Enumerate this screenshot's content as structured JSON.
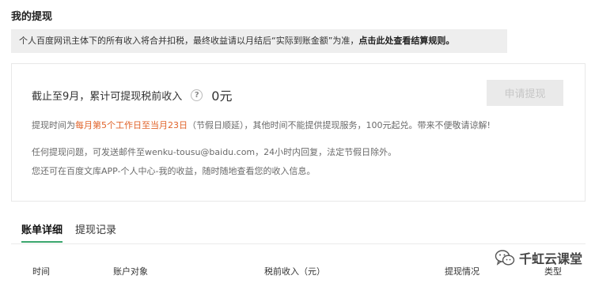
{
  "page_title": "我的提现",
  "notice": {
    "text": "个人百度网讯主体下的所有收入将合并扣税，最终收益请以月结后“实际到账金额”为准，",
    "link_text": "点击此处查看结算规则。"
  },
  "summary": {
    "balance_label": "截止至9月，累计可提现税前收入",
    "help_symbol": "?",
    "amount": "0元",
    "apply_button": "申请提现",
    "rule": {
      "prefix": "提现时间为",
      "highlight": "每月第5个工作日至当月23日",
      "suffix": "（节假日顺延），其他时间不能提供提现服务，100元起兑。带来不便敬请谅解!"
    },
    "info_lines": [
      "任何提现问题，可发送邮件至wenku-tousu@baidu.com，24小时内回复，法定节假日除外。",
      "您还可在百度文库APP-个人中心-我的收益，随时随地查看您的收入信息。"
    ]
  },
  "tabs": [
    "账单详细",
    "提现记录"
  ],
  "table_columns": [
    "时间",
    "账户对象",
    "税前收入（元）",
    "提现情况",
    "类型"
  ],
  "watermark": {
    "icon": "wechat-icon",
    "text": "千虹云课堂"
  },
  "colors": {
    "accent_green": "#3aa66d",
    "highlight_orange": "#e0632a",
    "notice_bg": "#eeeeee"
  }
}
